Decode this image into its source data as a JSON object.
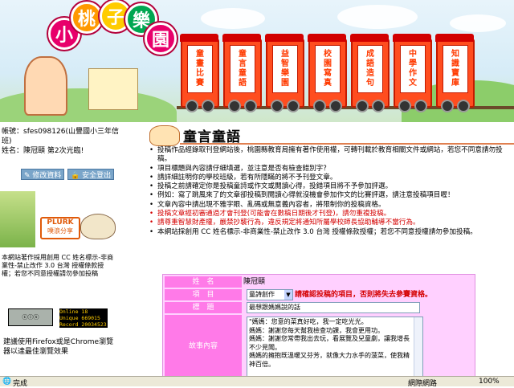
{
  "header": {
    "logo_chars": [
      "小",
      "桃",
      "子",
      "樂",
      "園"
    ],
    "train_cars": [
      [
        "童",
        "畫",
        "比",
        "賽"
      ],
      [
        "童",
        "言",
        "童",
        "語"
      ],
      [
        "益",
        "智",
        "樂",
        "園"
      ],
      [
        "校",
        "園",
        "寫",
        "真"
      ],
      [
        "成",
        "語",
        "造",
        "句"
      ],
      [
        "中",
        "學",
        "作",
        "文"
      ],
      [
        "知",
        "識",
        "寶",
        "庫"
      ]
    ]
  },
  "sidebar": {
    "account_label": "帳號：sfes098126(山豐國小三年信班)",
    "name_label": "姓名：陳冠頤 第2次光臨!",
    "edit_button": "修改資料",
    "logout_button": "安全登出",
    "plurk_label": "PLURK",
    "plurk_sub": "噗浪分享",
    "license_note": "本網站著作採用創用 CC 姓名標示-非商業性-禁止改作 3.0 台灣 授權條款授權；若您不同意授權請勿參加投稿",
    "counter_online": "Online",
    "counter_online_val": "18",
    "counter_unique": "Unique",
    "counter_unique_val": "669015",
    "counter_record": "Record",
    "counter_record_val": "20034523",
    "browser_note": "建議使用Firefox或是Chrome瀏覽器以達最佳瀏覽效果"
  },
  "main": {
    "title": "童言童語",
    "rules": [
      "投稿作品經錄取刊登網站後，桃園縣教育局擁有著作使用權，可轉刊載於教育相關文件或網站，若您不同意請勿投稿。",
      "項目標題與內容請仔細填選，並注意是否有檢查錯別字？",
      "請詳細註明你的學校班級，若有所隱瞞的將不予刊登文章。",
      "投稿之前請確定你是投稿童詩或作文或閱讀心得，投錯項目將不予參加評選。",
      "例如：寫了跳風來了的文章卻投稿到閱讀心得就沒機會參加作文的比賽評選，請注意投稿項目喔！",
      "文章內容中請出現不雅字眼、亂碼或無意義內容者，將限制你的投稿資格。",
      "投稿文章經初審通過才會刊登(可能會在數稿日期後才刊登)，請勿重複投稿。",
      "請尊重智慧財產權，嚴禁抄襲行為，違反規定將通知所屬學校師長協助輔導不當行為。",
      "本網站採創用 CC 姓名標示-非商業性-禁止改作 3.0 台灣 授權條款授權；若您不同意授權請勿參加投稿。"
    ],
    "form": {
      "name_label": "姓　名",
      "name_value": "陳冠頤",
      "item_label": "項　目",
      "item_value": "童詩創作",
      "item_hint": "請確認投稿的項目，否則將失去參賽資格。",
      "title_label": "標　題",
      "title_value": "最想跟媽媽說的話",
      "content_label": "故事內容",
      "content_value": "\"媽媽：您意的菜真好吃，我一定吃光光。\n媽媽：謝謝您每天幫我檢查功課，我會更用功。\n媽媽：謝謝您常帶我出去玩，看展覽及兒童劇，讓我增長不少見聞。\n媽媽的擁抱既溫暖又芬芳，就像大力水手的菠菜，使我精神百倍。"
    }
  },
  "statusbar": {
    "status": "完成",
    "zone": "網際網路",
    "zoom": "100%"
  }
}
